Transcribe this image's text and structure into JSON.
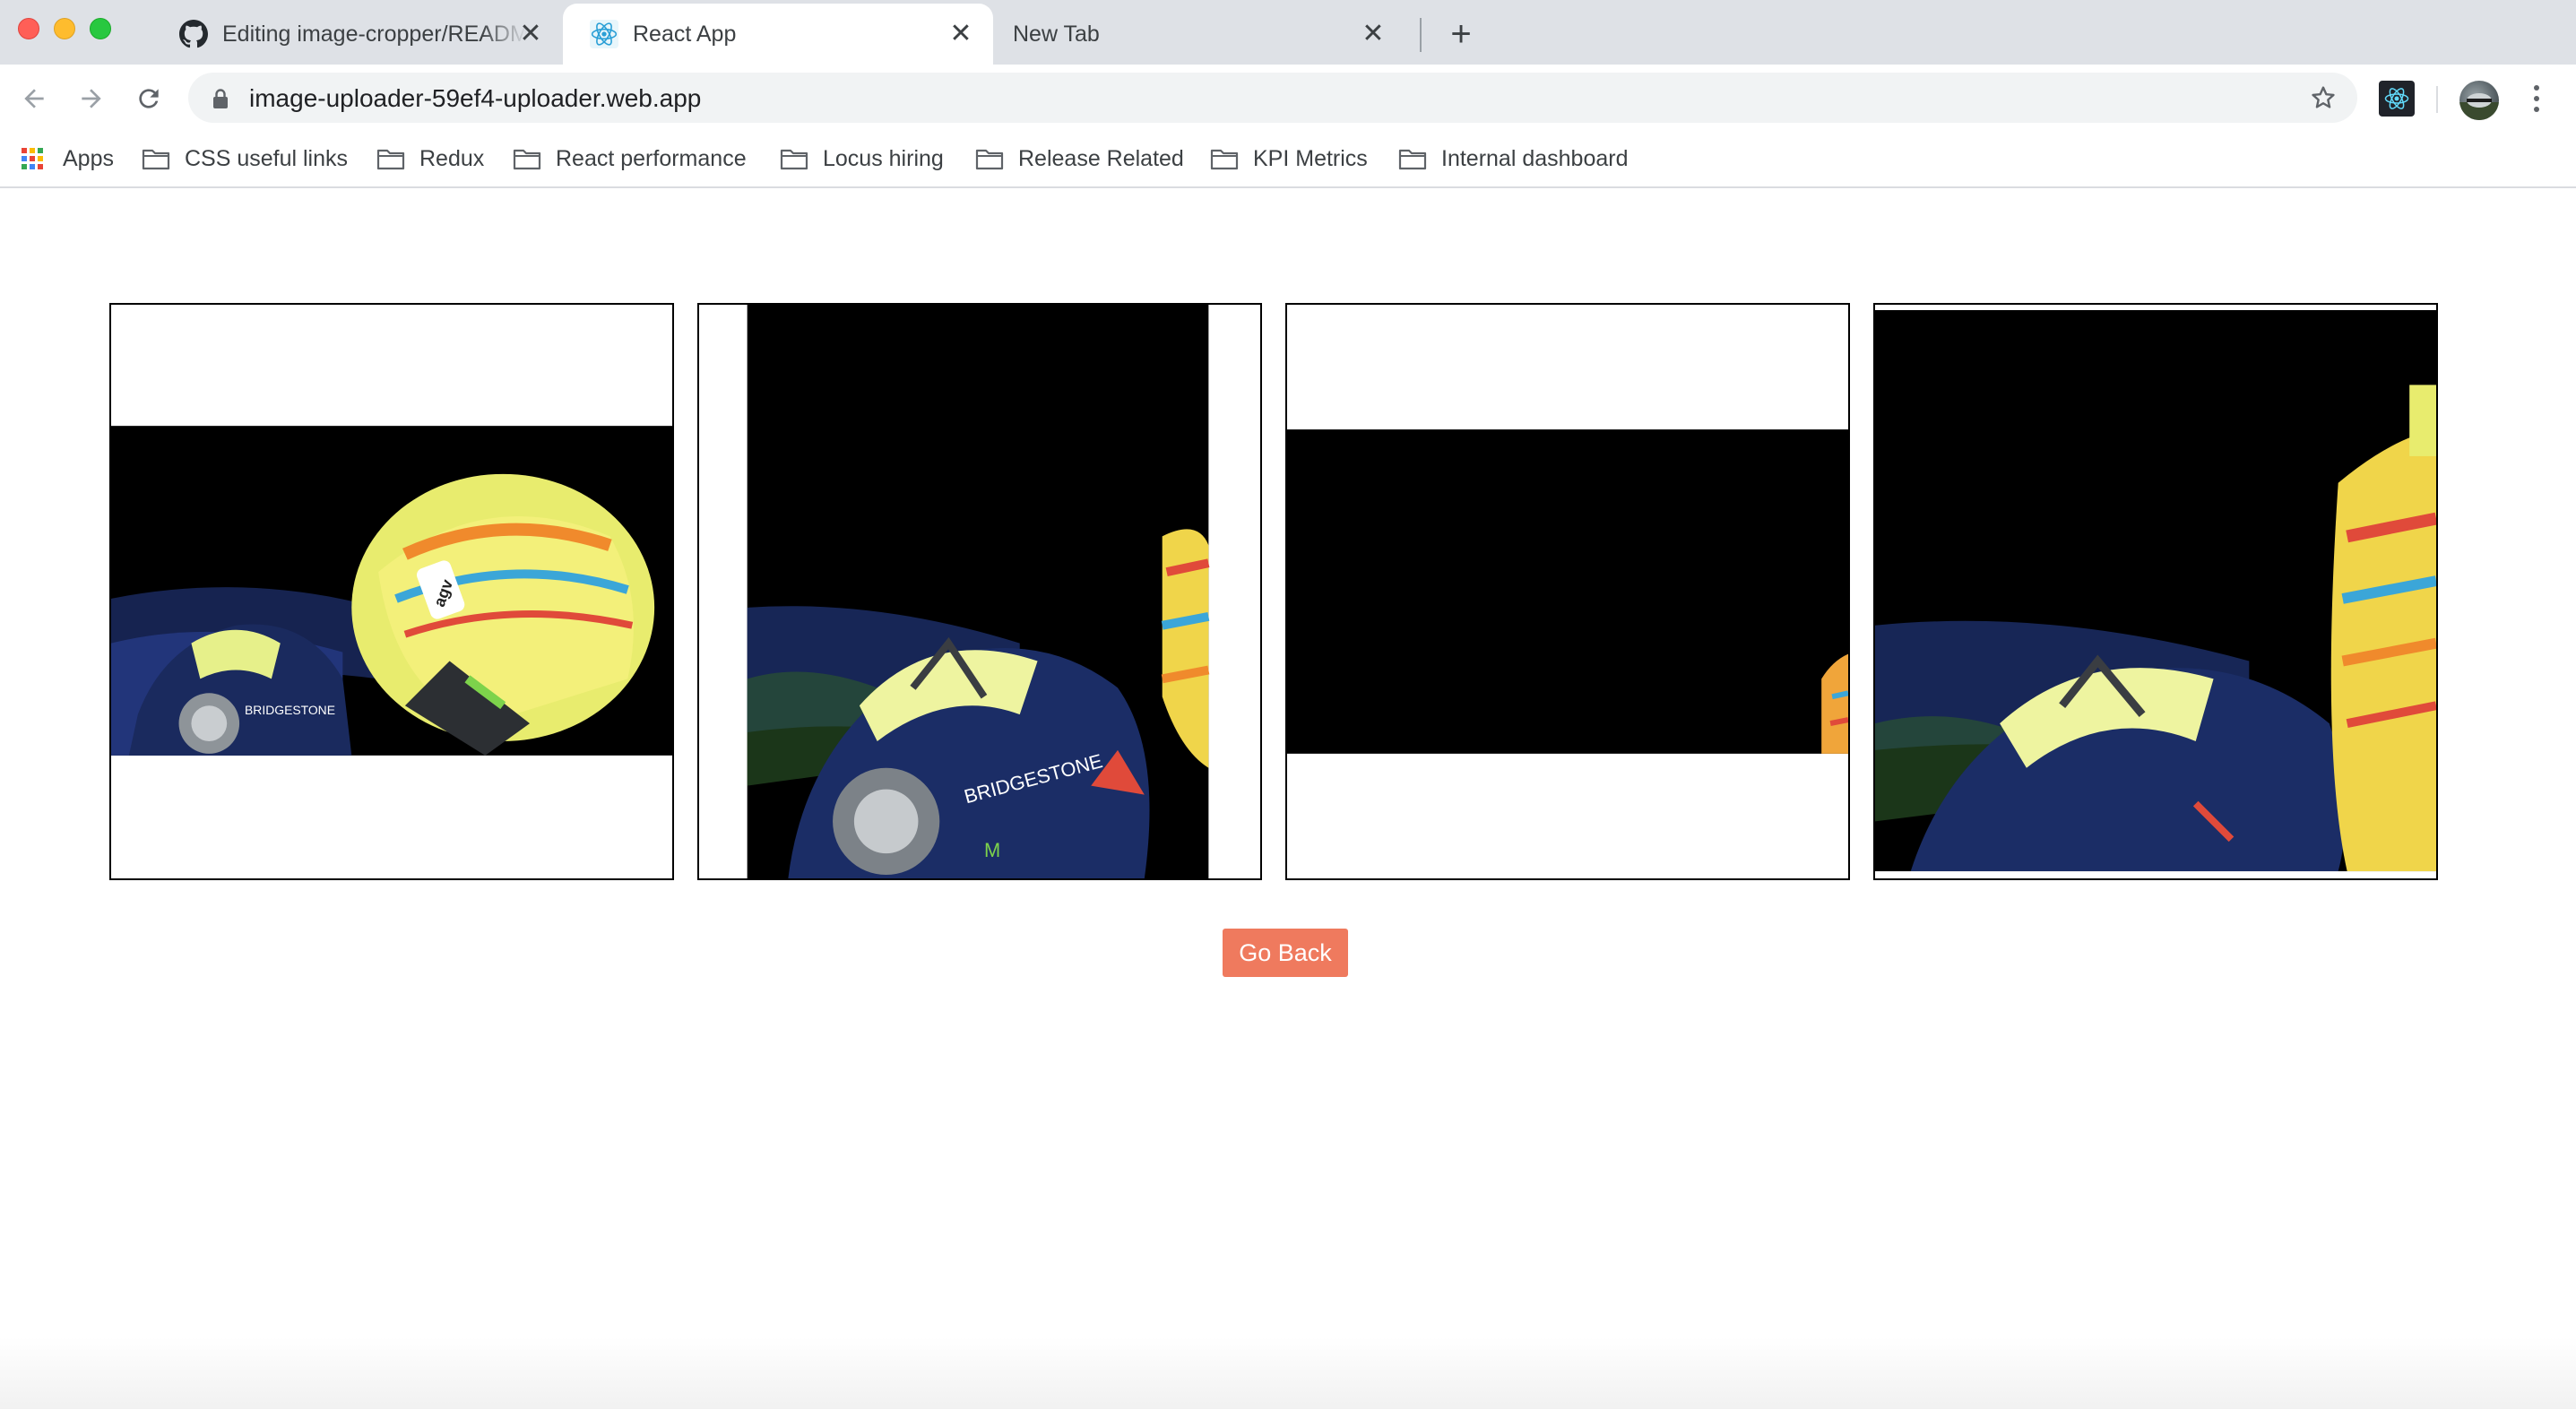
{
  "browser": {
    "tabs": [
      {
        "title": "Editing image-cropper/README.md",
        "icon": "github-icon",
        "active": false
      },
      {
        "title": "React App",
        "icon": "react-icon",
        "active": true
      },
      {
        "title": "New Tab",
        "icon": "",
        "active": false
      }
    ],
    "close_glyph": "✕",
    "new_tab_glyph": "+",
    "url": "image-uploader-59ef4-uploader.web.app",
    "bookmarks": [
      {
        "label": "Apps",
        "icon": "apps-grid-icon"
      },
      {
        "label": "CSS useful links",
        "icon": "folder-icon"
      },
      {
        "label": "Redux",
        "icon": "folder-icon"
      },
      {
        "label": "React performance",
        "icon": "folder-icon"
      },
      {
        "label": "Locus hiring",
        "icon": "folder-icon"
      },
      {
        "label": "Release Related",
        "icon": "folder-icon"
      },
      {
        "label": "KPI Metrics",
        "icon": "folder-icon"
      },
      {
        "label": "Internal dashboard",
        "icon": "folder-icon"
      }
    ]
  },
  "page": {
    "cropped_images": [
      {
        "crop": "horizontal",
        "subject": "rider with helmet"
      },
      {
        "crop": "vertical",
        "subject": "rider glove close-up"
      },
      {
        "crop": "small",
        "subject": "dark crop with colorful edge"
      },
      {
        "crop": "gallery",
        "subject": "rider glove close-up"
      }
    ],
    "go_back_label": "Go Back"
  },
  "colors": {
    "tabstrip_bg": "#dee1e6",
    "button_accent": "#ef7a5e",
    "omnibox_bg": "#f1f3f4"
  }
}
